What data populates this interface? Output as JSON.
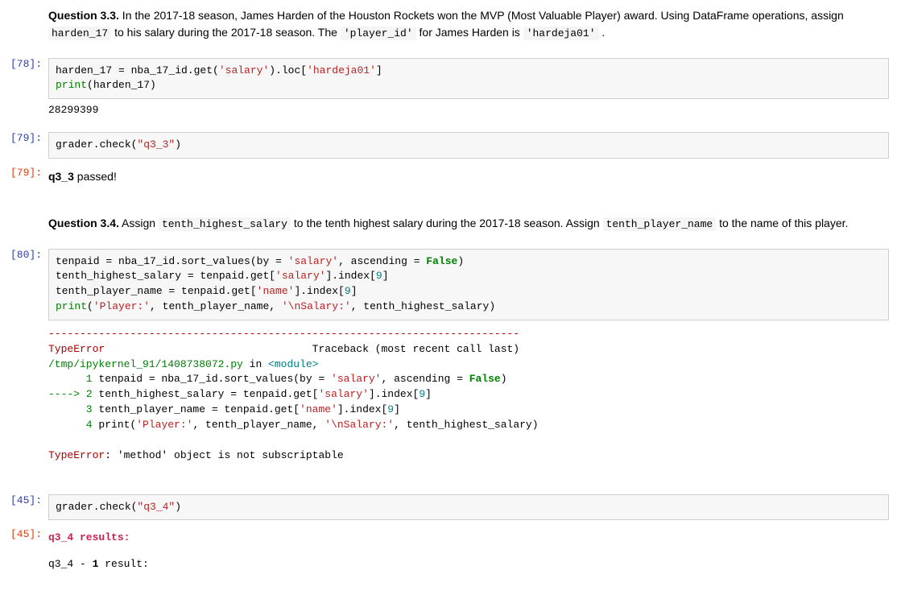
{
  "q33": {
    "label": "Question 3.3.",
    "text_a": " In the 2017-18 season, James Harden of the Houston Rockets won the MVP (Most Valuable Player) award. Using DataFrame operations, assign ",
    "code_a": "harden_17",
    "text_b": " to his salary during the 2017-18 season. The ",
    "code_b": "'player_id'",
    "text_c": " for James Harden is ",
    "code_c": "'hardeja01'",
    "text_d": " ."
  },
  "cell78": {
    "prompt": "[78]:",
    "line1_a": "harden_17 = nba_17_id.get(",
    "line1_b": "'salary'",
    "line1_c": ").loc[",
    "line1_d": "'hardeja01'",
    "line1_e": "]",
    "line2_a": "print",
    "line2_b": "(harden_17)",
    "output": "28299399"
  },
  "cell79": {
    "prompt_in": "[79]:",
    "prompt_out": "[79]:",
    "code_a": "grader.check(",
    "code_b": "\"q3_3\"",
    "code_c": ")",
    "out_a": "q3_3",
    "out_b": " passed!"
  },
  "q34": {
    "label": "Question 3.4.",
    "text_a": " Assign ",
    "code_a": "tenth_highest_salary",
    "text_b": " to the tenth highest salary during the 2017-18 season. Assign ",
    "code_b": "tenth_player_name",
    "text_c": " to the name of this player."
  },
  "cell80": {
    "prompt": "[80]:",
    "l1_a": "tenpaid = nba_17_id.sort_values(by = ",
    "l1_b": "'salary'",
    "l1_c": ", ascending = ",
    "l1_d": "False",
    "l1_e": ")",
    "l2_a": "tenth_highest_salary = tenpaid.get[",
    "l2_b": "'salary'",
    "l2_c": "].index[",
    "l2_d": "9",
    "l2_e": "]",
    "l3_a": "tenth_player_name = tenpaid.get[",
    "l3_b": "'name'",
    "l3_c": "].index[",
    "l3_d": "9",
    "l3_e": "]",
    "l4_a": "print",
    "l4_b": "(",
    "l4_c": "'Player:'",
    "l4_d": ", tenth_player_name, ",
    "l4_e": "'\\nSalary:'",
    "l4_f": ", tenth_highest_salary)"
  },
  "tb": {
    "dash": "---------------------------------------------------------------------------",
    "err_name": "TypeError",
    "trace_label": "                                 Traceback (most recent call last)",
    "file_a": "/tmp/ipykernel_91/1408738072.py",
    "file_b": " in ",
    "file_c": "<module>",
    "r1_num": "      1",
    "r1_txt": " tenpaid = nba_17_id.sort_values(by = ",
    "r1_str": "'salary'",
    "r1_mid": ", ascending = ",
    "r1_kw": "False",
    "r1_end": ")",
    "arrow": "----> ",
    "r2_num": "2",
    "r2_txt": " tenth_highest_salary = tenpaid.get[",
    "r2_str": "'salary'",
    "r2_mid": "].index[",
    "r2_n": "9",
    "r2_end": "]",
    "r3_num": "      3",
    "r3_txt": " tenth_player_name = tenpaid.get[",
    "r3_str": "'name'",
    "r3_mid": "].index[",
    "r3_n": "9",
    "r3_end": "]",
    "r4_num": "      4",
    "r4_print": " print",
    "r4_open": "(",
    "r4_s1": "'Player:'",
    "r4_mid1": ", tenth_player_name, ",
    "r4_s2": "'\\nSalary:'",
    "r4_mid2": ", tenth_highest_salary)",
    "blank": "",
    "final_a": "TypeError",
    "final_b": ": 'method' object is not subscriptable"
  },
  "cell45": {
    "prompt_in": "[45]:",
    "prompt_out": "[45]:",
    "code_a": "grader.check(",
    "code_b": "\"q3_4\"",
    "code_c": ")",
    "res_head": "q3_4 results:",
    "res_sub_a": "q3_4 - ",
    "res_sub_b": "1",
    "res_sub_c": " result:"
  }
}
